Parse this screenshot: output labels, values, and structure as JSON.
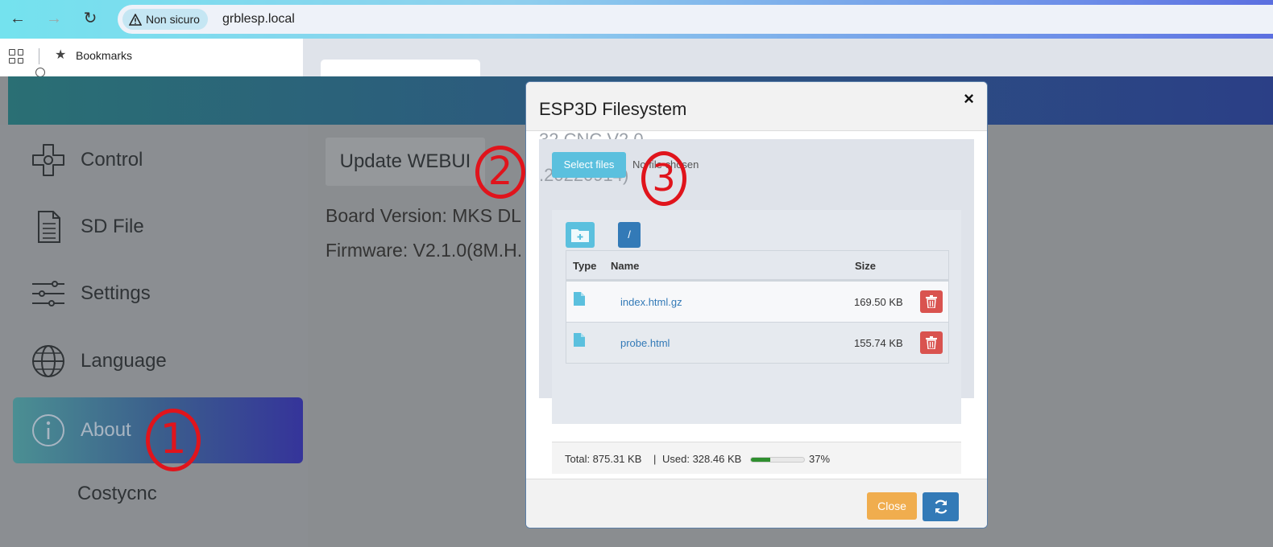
{
  "browser": {
    "security_label": "Non sicuro",
    "url": "grblesp.local",
    "bookmarks_label": "Bookmarks"
  },
  "sidebar": {
    "items": [
      {
        "label": "Control",
        "icon": "dpad-icon"
      },
      {
        "label": "SD File",
        "icon": "document-icon"
      },
      {
        "label": "Settings",
        "icon": "sliders-icon"
      },
      {
        "label": "Language",
        "icon": "globe-icon"
      },
      {
        "label": "About",
        "icon": "info-icon",
        "active": true
      }
    ],
    "footer_label": "Costycnc"
  },
  "main": {
    "update_button": "Update WEBUI",
    "board_version": "Board Version: MKS DL",
    "firmware": "Firmware: V2.1.0(8M.H."
  },
  "annotations": [
    "1",
    "2",
    "3"
  ],
  "modal": {
    "title": "ESP3D Filesystem",
    "close_symbol": "×",
    "ghost_line_1": "32 CNC V2.0",
    "ghost_line_2": ".20220914)",
    "select_files_label": "Select files",
    "file_chosen_text": "No file chosen",
    "path_label": "/",
    "table": {
      "headers": {
        "type": "Type",
        "name": "Name",
        "size": "Size"
      },
      "rows": [
        {
          "name": "index.html.gz",
          "size": "169.50 KB"
        },
        {
          "name": "probe.html",
          "size": "155.74 KB"
        }
      ]
    },
    "footer": {
      "total": "Total: 875.31 KB",
      "separator": "|",
      "used": "Used: 328.46 KB",
      "percent_label": "37%",
      "used_fraction": 0.37
    },
    "close_button": "Close"
  },
  "colors": {
    "accent": "#337ab7",
    "info": "#5bc0de",
    "danger": "#d9534f",
    "warning": "#f0ad4e",
    "annotation": "#e0141c"
  }
}
